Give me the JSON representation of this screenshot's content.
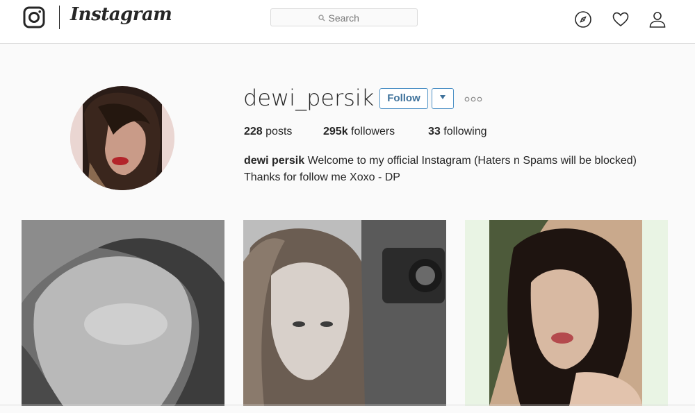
{
  "header": {
    "logo_text": "Instagram",
    "search_placeholder": "Search",
    "icons": [
      "instagram-camera-icon",
      "compass-icon",
      "heart-icon",
      "person-icon"
    ]
  },
  "profile": {
    "username": "dewi_persik",
    "follow_label": "Follow",
    "stats": {
      "posts_count": "228",
      "posts_label": "posts",
      "followers_count": "295k",
      "followers_label": "followers",
      "following_count": "33",
      "following_label": "following"
    },
    "full_name": "dewi persik",
    "bio_line1": "Welcome to my official Instagram (Haters n Spams will be blocked)",
    "bio_line2": "Thanks for follow me Xoxo - DP"
  },
  "colors": {
    "accent": "#3f729b",
    "button_border": "#4f92c6",
    "text": "#262626",
    "background": "#fafafa",
    "border": "#dbdbdb"
  }
}
